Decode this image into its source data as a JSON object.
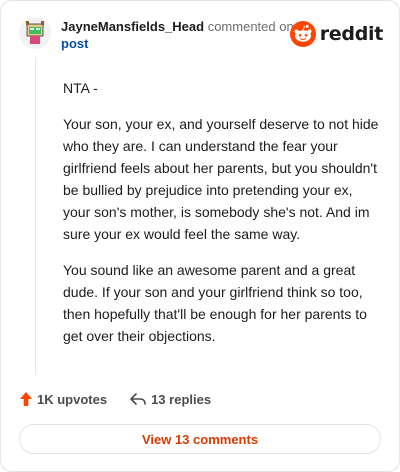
{
  "comment": {
    "username": "JayneMansfields_Head",
    "action": "commented on",
    "post_link": "post",
    "paragraphs": [
      "NTA -",
      "Your son, your ex, and yourself deserve to not hide who they are. I can understand the fear your girlfriend feels about her parents, but you shouldn't be bullied by prejudice into pretending your ex, your son's mother, is somebody she's not. And im sure your ex would feel the same way.",
      "You sound like an awesome parent and a great dude. If your son and your girlfriend think so too, then hopefully that'll be enough for her parents to get over their objections."
    ]
  },
  "brand": {
    "wordmark": "reddit",
    "icon": "reddit-snoo-icon",
    "color": "#ff4500"
  },
  "stats": {
    "upvotes": "1K upvotes",
    "upvote_icon": "upvote-arrow-icon",
    "upvote_color": "#ff4500",
    "replies": "13 replies",
    "reply_icon": "reply-arrow-icon"
  },
  "footer": {
    "view_comments": "View 13 comments",
    "accent": "#d93a00"
  },
  "avatar": {
    "icon": "snoo-avatar-icon"
  }
}
